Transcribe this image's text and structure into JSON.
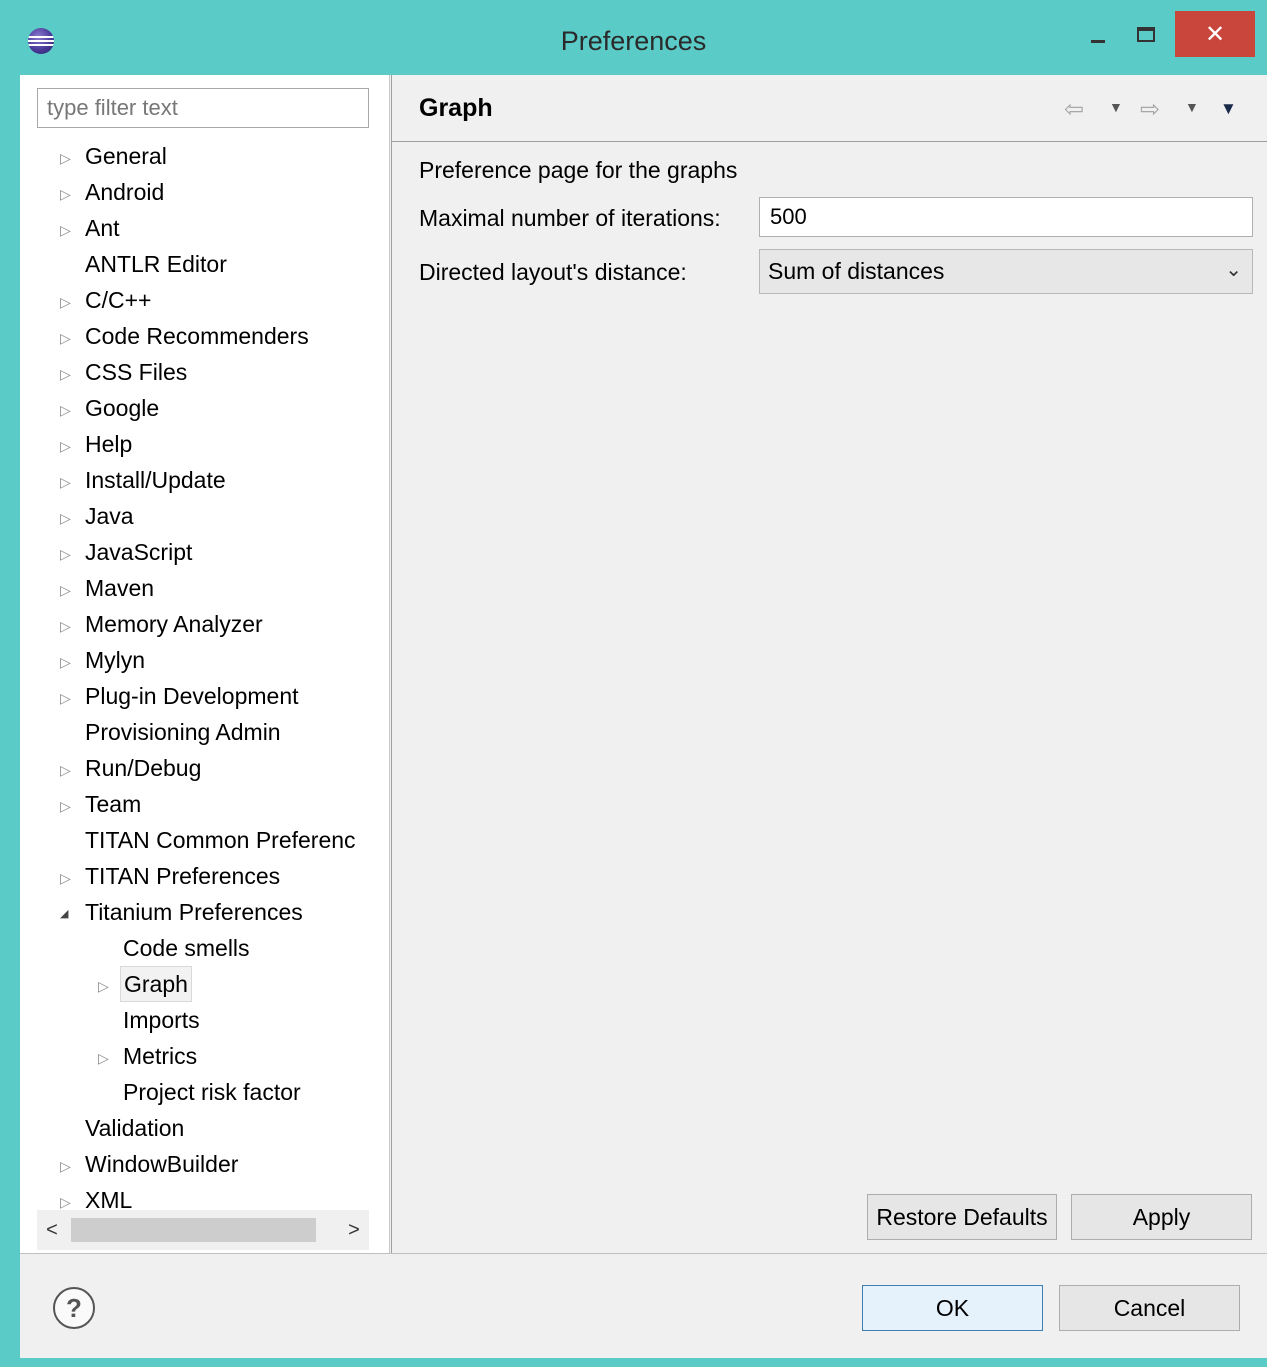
{
  "window": {
    "title": "Preferences",
    "close_glyph": "✕"
  },
  "filter": {
    "placeholder": "type filter text"
  },
  "tree": {
    "items": [
      {
        "label": "General",
        "expander": "collapsed"
      },
      {
        "label": "Android",
        "expander": "collapsed"
      },
      {
        "label": "Ant",
        "expander": "collapsed"
      },
      {
        "label": "ANTLR Editor",
        "expander": "none"
      },
      {
        "label": "C/C++",
        "expander": "collapsed"
      },
      {
        "label": "Code Recommenders",
        "expander": "collapsed"
      },
      {
        "label": "CSS Files",
        "expander": "collapsed"
      },
      {
        "label": "Google",
        "expander": "collapsed"
      },
      {
        "label": "Help",
        "expander": "collapsed"
      },
      {
        "label": "Install/Update",
        "expander": "collapsed"
      },
      {
        "label": "Java",
        "expander": "collapsed"
      },
      {
        "label": "JavaScript",
        "expander": "collapsed"
      },
      {
        "label": "Maven",
        "expander": "collapsed"
      },
      {
        "label": "Memory Analyzer",
        "expander": "collapsed"
      },
      {
        "label": "Mylyn",
        "expander": "collapsed"
      },
      {
        "label": "Plug-in Development",
        "expander": "collapsed"
      },
      {
        "label": "Provisioning Admin",
        "expander": "none"
      },
      {
        "label": "Run/Debug",
        "expander": "collapsed"
      },
      {
        "label": "Team",
        "expander": "collapsed"
      },
      {
        "label": "TITAN Common Preferenc",
        "expander": "none"
      },
      {
        "label": "TITAN Preferences",
        "expander": "collapsed"
      },
      {
        "label": "Titanium Preferences",
        "expander": "expanded"
      },
      {
        "label": "Code smells",
        "expander": "none",
        "child": true
      },
      {
        "label": "Graph",
        "expander": "collapsed",
        "child": true,
        "selected": true
      },
      {
        "label": "Imports",
        "expander": "none",
        "child": true
      },
      {
        "label": "Metrics",
        "expander": "collapsed",
        "child": true
      },
      {
        "label": "Project risk factor",
        "expander": "none",
        "child": true
      },
      {
        "label": "Validation",
        "expander": "none"
      },
      {
        "label": "WindowBuilder",
        "expander": "collapsed"
      },
      {
        "label": "XML",
        "expander": "collapsed"
      }
    ]
  },
  "page": {
    "title": "Graph",
    "description": "Preference page for the graphs",
    "iterations_label": "Maximal number of iterations:",
    "iterations_value": "500",
    "distance_label": "Directed layout's distance:",
    "distance_value": "Sum of distances"
  },
  "buttons": {
    "restore_defaults": "Restore Defaults",
    "apply": "Apply",
    "ok": "OK",
    "cancel": "Cancel"
  },
  "icons": {
    "back": "back-arrow-icon",
    "forward": "forward-arrow-icon",
    "menu": "view-menu-icon",
    "help": "help-icon"
  }
}
